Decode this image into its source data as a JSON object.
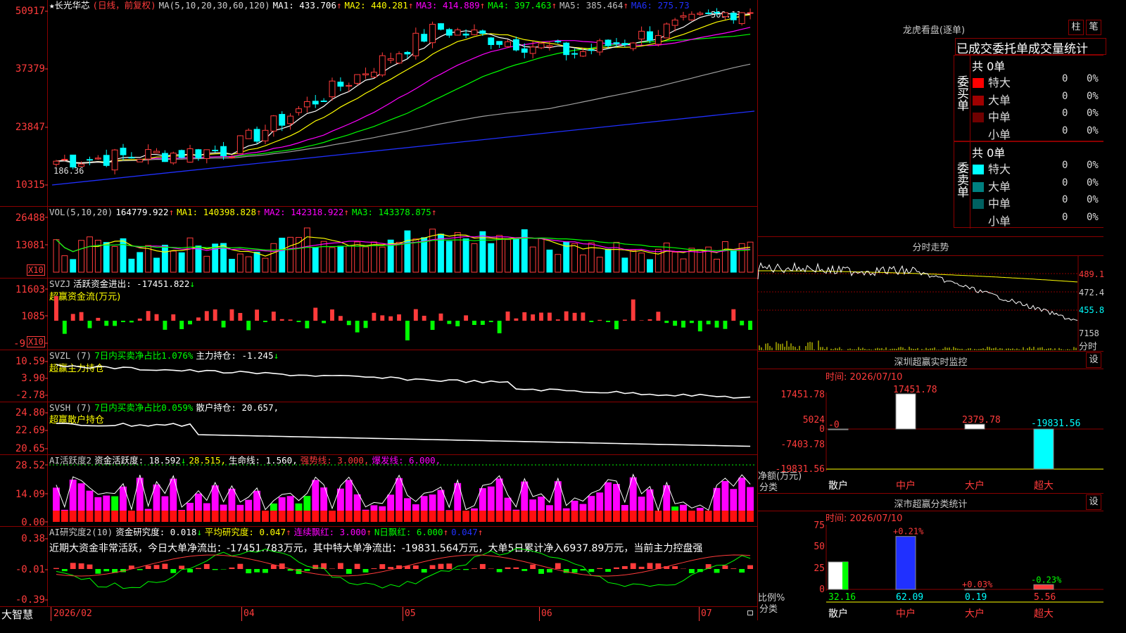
{
  "colors": {
    "up": "#ff3b3b",
    "down": "#00ffff",
    "bg": "#000000",
    "grid": "#8a0000",
    "white": "#ffffff",
    "yellow": "#ffff00",
    "magenta": "#ff00ff",
    "green": "#00ff00",
    "blue": "#2030ff",
    "gray": "#a0a0a0"
  },
  "main": {
    "star": "★",
    "stock_name": "长光华芯",
    "period": "(日线，前复权)",
    "ma_def": "MA(5,10,20,30,60,120)",
    "ma1": "MA1: 433.706",
    "ma2": "MA2: 440.281",
    "ma3": "MA3: 414.889",
    "ma4": "MA4: 397.463",
    "ma5": "MA5: 385.464",
    "ma6": "MA6: 275.73",
    "up_arrow": "↑",
    "high_label": "509.11",
    "low_label": "186.36",
    "y_labels": [
      "50917",
      "37379",
      "23847",
      "10315"
    ]
  },
  "vol": {
    "title": "VOL(5,10,20)",
    "value": "164779.922",
    "ma1": "MA1: 140398.828",
    "ma2": "MA2: 142318.922",
    "ma3": "MA3: 143378.875",
    "y_labels": [
      "26488",
      "13081"
    ],
    "unit": "X10"
  },
  "svzj": {
    "title": "SVZJ",
    "text": "活跃资金进出: -17451.822",
    "down_arrow": "↓",
    "sub": "超赢资金流(万元)",
    "y_labels": [
      "11603",
      "1085",
      "-9"
    ],
    "unit": "X10"
  },
  "svzl": {
    "title": "SVZL (7)",
    "text1": "7日内买卖净占比1.076%",
    "text2": "主力持仓: -1.245",
    "down_arrow": "↓",
    "sub": "超赢主力持仓",
    "y_labels": [
      "10.59",
      "3.90",
      "-2.78"
    ]
  },
  "svsh": {
    "title": "SVSH (7)",
    "text1": "7日内买卖净占比0.059%",
    "text2": "散户持仓: 20.657,",
    "sub": "超赢散户持仓",
    "y_labels": [
      "24.80",
      "22.69",
      "20.65"
    ]
  },
  "ai1": {
    "title": "AI活跃度2",
    "t1": "资金活跃度: 18.592",
    "t2": "28.515,",
    "t3": "生命线: 1.560,",
    "t4": "强势线: 3.000,",
    "t5": "爆发线: 6.000,",
    "down_arrow": "↓",
    "y_labels": [
      "28.52",
      "14.09",
      "0.00"
    ]
  },
  "ai2": {
    "title": "AI研究度2(10)",
    "t1": "资金研究度: 0.018",
    "t2": "平均研究度: 0.047",
    "t3": "连续飘红: 3.000",
    "t4": "N日飘红: 6.000",
    "t5": "0.047",
    "comment": "近期大资金非常活跃，今日大单净流出：-17451.783万元，其中特大单净流出：-19831.564万元，大单5日累计净入6937.89万元，当前主力控盘强",
    "y_labels": [
      "0.38",
      "-0.01",
      "-0.39"
    ]
  },
  "footer": {
    "brand": "大智慧",
    "dates": [
      "2026/02",
      "04",
      "05",
      "06",
      "07"
    ]
  },
  "lhb": {
    "title": "龙虎看盘(逐单)",
    "btn_zhu": "柱",
    "btn_bi": "笔",
    "tabs": "已成交委托单成交量统计",
    "buy_label": "委买单",
    "sell_label": "委卖单",
    "buy_total": "共 0单",
    "sell_total": "共 0单",
    "buy_rows": [
      {
        "label": "特大",
        "count": "0",
        "pct": "0%",
        "color": "#ff0000"
      },
      {
        "label": "大单",
        "count": "0",
        "pct": "0%",
        "color": "#a00000"
      },
      {
        "label": "中单",
        "count": "0",
        "pct": "0%",
        "color": "#700000"
      },
      {
        "label": "小单",
        "count": "0",
        "pct": "0%",
        "color": "#000000"
      }
    ],
    "sell_rows": [
      {
        "label": "特大",
        "count": "0",
        "pct": "0%",
        "color": "#00ffff"
      },
      {
        "label": "大单",
        "count": "0",
        "pct": "0%",
        "color": "#008080"
      },
      {
        "label": "中单",
        "count": "0",
        "pct": "0%",
        "color": "#006060"
      },
      {
        "label": "小单",
        "count": "0",
        "pct": "0%",
        "color": "#000000"
      }
    ]
  },
  "fenshi": {
    "title": "分时走势",
    "y_labels": [
      "489.1",
      "472.4",
      "455.8"
    ],
    "vol_label": "7158",
    "fs_label": "分时"
  },
  "szmon": {
    "title": "深圳超赢实时监控",
    "setting": "设",
    "time": "时间: 2026/07/10",
    "y_labels": [
      "17451.78",
      "5024",
      "0",
      "-7403.78",
      "-19831.56"
    ],
    "bars": [
      {
        "cat": "散户",
        "value": -0.0,
        "label": "-0",
        "color": "#ffffff"
      },
      {
        "cat": "中户",
        "value": 17451.78,
        "label": "17451.78",
        "color": "#ffffff"
      },
      {
        "cat": "大户",
        "value": 2379.78,
        "label": "2379.78",
        "color": "#ffffff"
      },
      {
        "cat": "超大",
        "value": -19831.56,
        "label": "-19831.56",
        "color": "#00ffff"
      }
    ],
    "xlabel": "净额(万元)",
    "xlabel2": "分类"
  },
  "szstat": {
    "title": "深市超赢分类统计",
    "setting": "设",
    "time": "时间: 2026/07/10",
    "y_labels": [
      "75",
      "50",
      "25",
      "0"
    ],
    "bars": [
      {
        "cat": "散户",
        "value": 32.16,
        "label": "32.16",
        "delta": ""
      },
      {
        "cat": "中户",
        "value": 62.09,
        "label": "62.09",
        "delta": "+0.21%"
      },
      {
        "cat": "大户",
        "value": 0.19,
        "label": "0.19",
        "delta": "+0.03%"
      },
      {
        "cat": "超大",
        "value": 5.56,
        "label": "5.56",
        "delta": "-0.23%"
      }
    ],
    "xlabel": "比例%",
    "xlabel2": "分类"
  },
  "chart_data": {
    "type": "candlestick",
    "title": "长光华芯 (日线，前复权)",
    "ylim": [
      10315,
      50917
    ],
    "high": 509.11,
    "low": 186.36
  }
}
